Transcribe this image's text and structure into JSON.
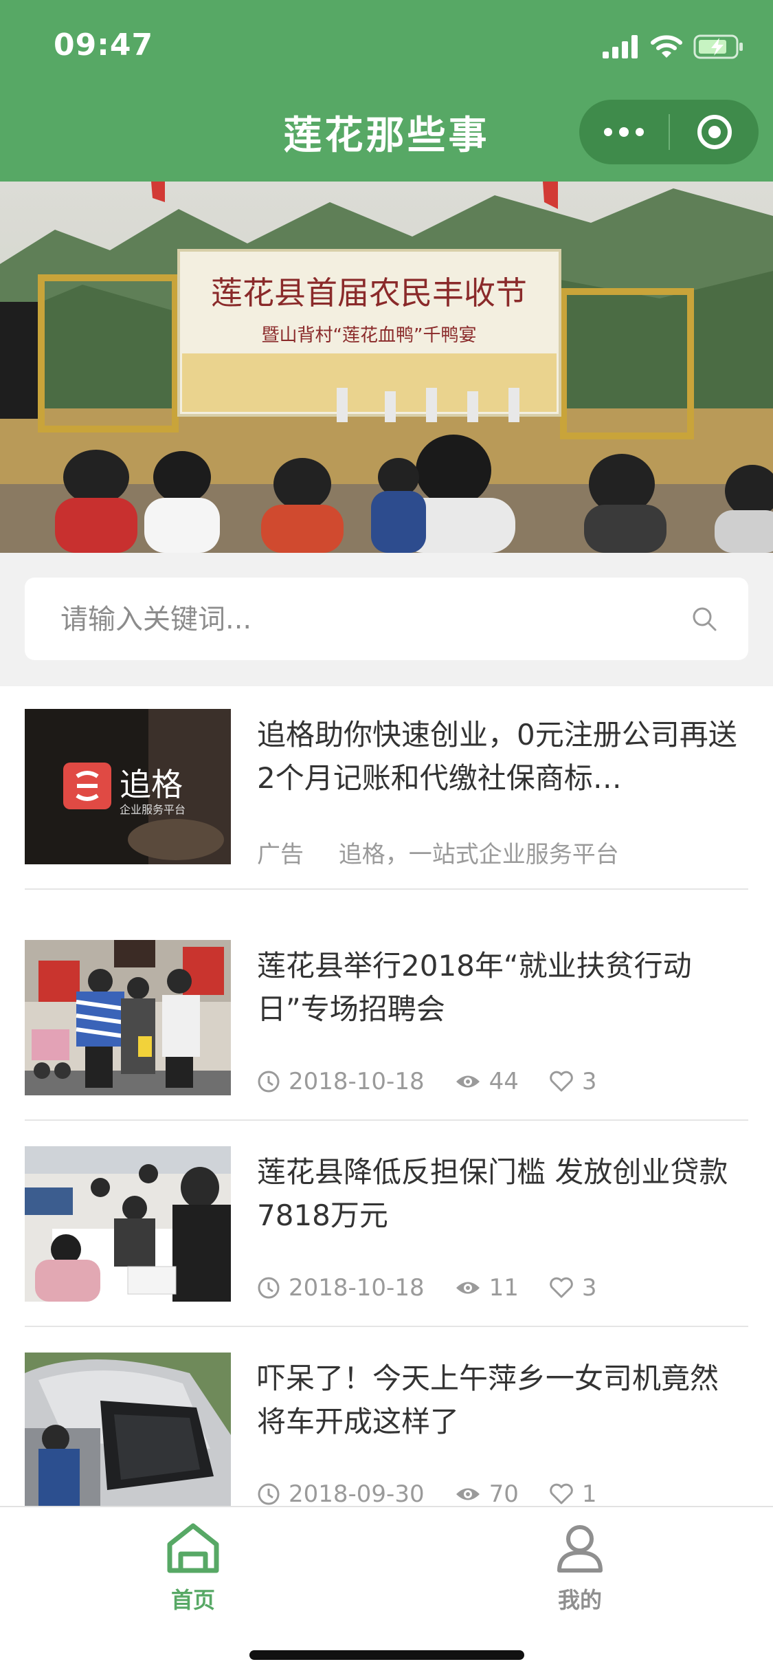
{
  "status_bar": {
    "time": "09:47"
  },
  "nav": {
    "title": "莲花那些事"
  },
  "banner": {
    "sign_line1": "莲花县首届农民丰收节",
    "sign_line2": "暨山背村“莲花血鸭”千鸭宴"
  },
  "search": {
    "placeholder": "请输入关键词..."
  },
  "ad": {
    "title": "追格助你快速创业，0元注册公司再送2个月记账和代缴社保商标…",
    "tag": "广告",
    "source": "追格，一站式企业服务平台",
    "brand": "追格",
    "brand_sub": "企业服务平台"
  },
  "articles": [
    {
      "title": "莲花县举行2018年“就业扶贫行动日”专场招聘会",
      "date": "2018-10-18",
      "views": "44",
      "likes": "3"
    },
    {
      "title": "莲花县降低反担保门槛 发放创业贷款7818万元",
      "date": "2018-10-18",
      "views": "11",
      "likes": "3"
    },
    {
      "title": "吓呆了！今天上午萍乡一女司机竟然将车开成这样了",
      "date": "2018-09-30",
      "views": "70",
      "likes": "1"
    }
  ],
  "tabbar": {
    "home_label": "首页",
    "mine_label": "我的"
  },
  "colors": {
    "primary": "#57a865",
    "capsule": "#3f8b4b",
    "meta_text": "#9a9a9a"
  },
  "icons": [
    "signal-icon",
    "wifi-icon",
    "battery-charging-icon",
    "more-dots-icon",
    "close-target-icon",
    "search-icon",
    "clock-icon",
    "eye-icon",
    "heart-icon",
    "home-icon",
    "user-icon"
  ]
}
